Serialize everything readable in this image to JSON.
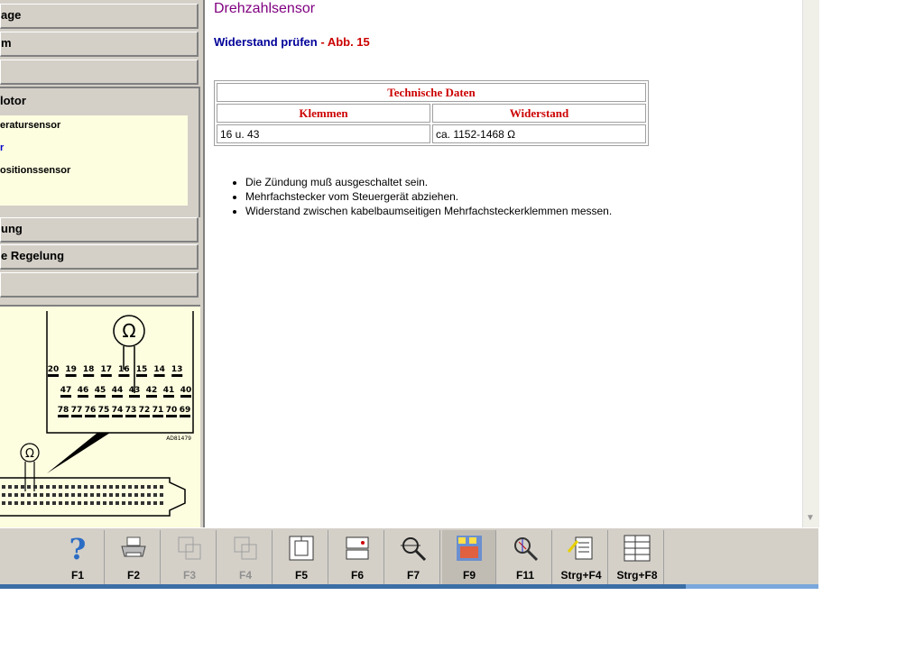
{
  "sidebar": {
    "items": [
      {
        "label": "age"
      },
      {
        "label": "m"
      },
      {
        "label": ""
      }
    ],
    "motor": {
      "label": "lotor",
      "sub_items": [
        {
          "label": "eratursensor"
        },
        {
          "label": "r"
        },
        {
          "label": "ositionssensor"
        }
      ]
    },
    "items_bottom": [
      {
        "label": "ung"
      },
      {
        "label": "e Regelung"
      },
      {
        "label": ""
      }
    ],
    "diagram": {
      "ohm_symbol": "Ω",
      "row1": [
        "20",
        "19",
        "18",
        "17",
        "16",
        "15",
        "14",
        "13"
      ],
      "row2": [
        "47",
        "46",
        "45",
        "44",
        "43",
        "42",
        "41",
        "40"
      ],
      "row3": [
        "78",
        "77",
        "76",
        "75",
        "74",
        "73",
        "72",
        "71",
        "70",
        "69"
      ],
      "code": "AD81479"
    }
  },
  "content": {
    "title": "Drehzahlsensor",
    "subtitle_blue": "Widerstand prüfen",
    "subtitle_sep": " - ",
    "subtitle_red": "Abb. 15",
    "table": {
      "caption": "Technische Daten",
      "headers": [
        "Klemmen",
        "Widerstand"
      ],
      "rows": [
        [
          "16 u. 43",
          "ca. 1152-1468 Ω"
        ]
      ]
    },
    "instructions": [
      "Die Zündung muß ausgeschaltet sein.",
      "Mehrfachstecker vom Steuergerät abziehen.",
      "Widerstand zwischen kabelbaumseitigen Mehrfachsteckerklemmen messen."
    ]
  },
  "toolbar": {
    "buttons": [
      {
        "label": "F1",
        "icon": "help-icon"
      },
      {
        "label": "F2",
        "icon": "printer-icon"
      },
      {
        "label": "F3",
        "icon": "copy-disabled-icon"
      },
      {
        "label": "F4",
        "icon": "paste-disabled-icon"
      },
      {
        "label": "F5",
        "icon": "component-icon"
      },
      {
        "label": "F6",
        "icon": "connector-icon"
      },
      {
        "label": "F7",
        "icon": "magnifier-icon"
      },
      {
        "label": "F9",
        "icon": "numbered-pages-icon"
      },
      {
        "label": "F11",
        "icon": "zoom-diagram-icon"
      },
      {
        "label": "Strg+F4",
        "icon": "notes-icon"
      },
      {
        "label": "Strg+F8",
        "icon": "list-icon"
      }
    ]
  },
  "colors": {
    "title": "#800080",
    "subtitle_blue": "#000099",
    "accent_red": "#cc0000",
    "panel_bg": "#d4d0c8",
    "yellow_bg": "#fdfde0"
  }
}
